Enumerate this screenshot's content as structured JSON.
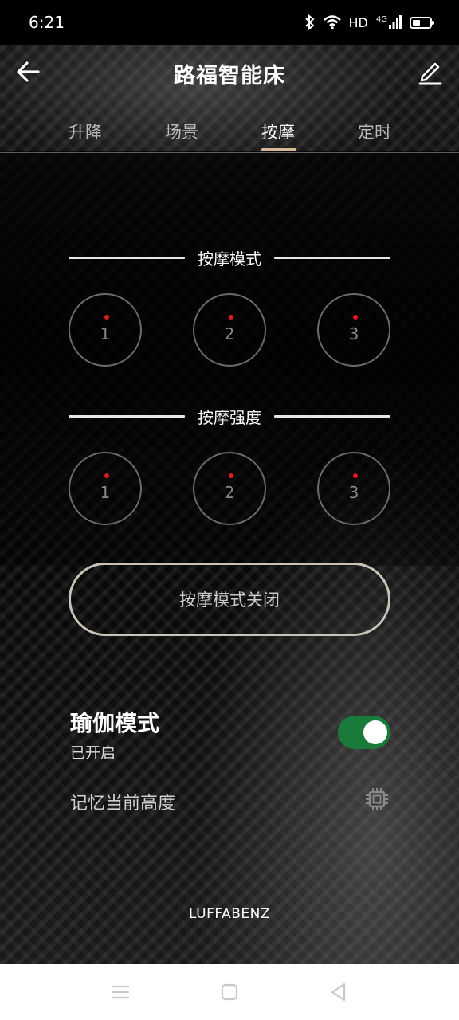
{
  "status_bar": {
    "time": "6:21",
    "network_label": "HD",
    "signal_label": "4G"
  },
  "header": {
    "title": "路福智能床"
  },
  "tabs": [
    {
      "label": "升降",
      "active": false
    },
    {
      "label": "场景",
      "active": false
    },
    {
      "label": "按摩",
      "active": true
    },
    {
      "label": "定时",
      "active": false
    }
  ],
  "massage_mode": {
    "heading": "按摩模式",
    "options": [
      "1",
      "2",
      "3"
    ]
  },
  "massage_intensity": {
    "heading": "按摩强度",
    "options": [
      "1",
      "2",
      "3"
    ]
  },
  "off_button": {
    "label": "按摩模式关闭"
  },
  "yoga": {
    "title": "瑜伽模式",
    "status": "已开启",
    "enabled": true
  },
  "memory": {
    "label": "记忆当前高度"
  },
  "brand": "LUFFABENZ",
  "colors": {
    "accent_tab": "#d9b99b",
    "toggle_on": "#1a7a3a",
    "indicator_dot": "#e31a1a"
  },
  "icons": {
    "back": "arrow-left-icon",
    "edit": "pencil-icon",
    "memory": "chip-icon",
    "nav_menu": "menu-icon",
    "nav_home": "square-icon",
    "nav_back": "triangle-back-icon"
  }
}
